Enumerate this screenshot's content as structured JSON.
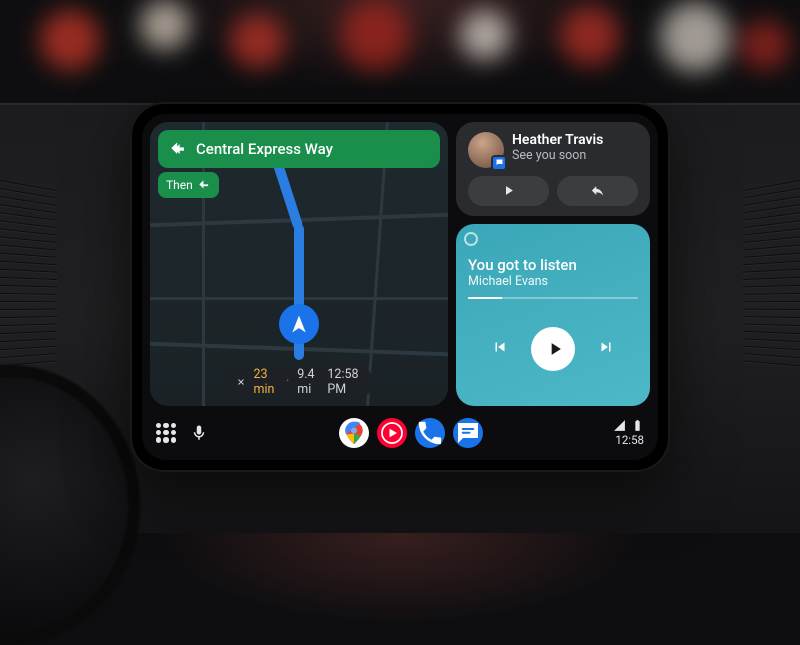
{
  "nav": {
    "direction_label": "Central Express Way",
    "then_label": "Then",
    "trip": {
      "eta_duration": "23 min",
      "distance": "9.4 mi",
      "arrival": "12:58 PM"
    }
  },
  "message": {
    "sender": "Heather Travis",
    "preview": "See you soon"
  },
  "media": {
    "title": "You got to listen",
    "artist": "Michael Evans",
    "progress_pct": 20
  },
  "status": {
    "clock": "12:58"
  },
  "icons": {
    "turn_left": "turn-left-icon",
    "close": "close-icon",
    "play_msg": "play-icon",
    "reply": "reply-icon",
    "prev": "skip-previous-icon",
    "play_media": "play-icon",
    "next": "skip-next-icon",
    "launcher": "app-launcher-icon",
    "mic": "microphone-icon",
    "signal": "cell-signal-icon",
    "battery": "battery-icon"
  }
}
